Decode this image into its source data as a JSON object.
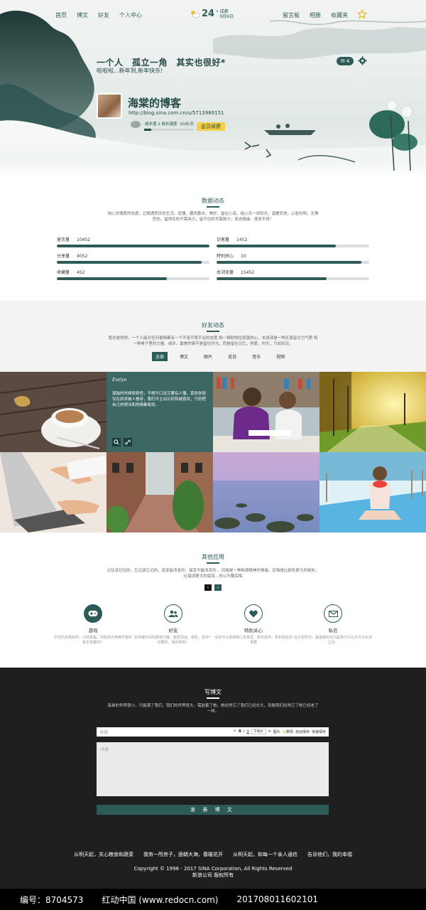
{
  "nav": {
    "left": [
      "首页",
      "博文",
      "好友",
      "个人中心"
    ],
    "right": [
      "留言板",
      "相册",
      "收藏夹"
    ]
  },
  "weather": {
    "temp": "24",
    "unit": "°",
    "city": "成都",
    "date": "9月6日"
  },
  "hero": {
    "motto": "一个人　孤立一角　其实也很好*",
    "sub_motto": "啦啦啦...新年到,新年快乐!",
    "badge": "4",
    "blog_title": "海棠的博客",
    "blog_url": "http://blog.sina.com.cn/u/5713989151",
    "growth_text": "成长值 1  成长速度 -10点/天",
    "growth_progress": 0.14,
    "renew_label": "会员续费"
  },
  "stats": {
    "title": "数据动态",
    "desc": "用心甘情愿的态度，过随遇而安的生活。道懂，趣风散去，美好，留在心底。给心灵一米阳光，温暖安放，心若向阳，无惧悲伤。留得住的不需用力，留不住的不需费力；来去随缘，很求不得！",
    "items": [
      {
        "label": "留言量",
        "value": "10452",
        "pct": 1.0
      },
      {
        "label": "访客量",
        "value": "1452",
        "pct": 0.78
      },
      {
        "label": "分享量",
        "value": "4052",
        "pct": 0.95
      },
      {
        "label": "特别关心",
        "value": "10",
        "pct": 0.95
      },
      {
        "label": "收藏量",
        "value": "452",
        "pct": 0.72
      },
      {
        "label": "总浏览量",
        "value": "15452",
        "pct": 0.72
      }
    ]
  },
  "friends": {
    "title": "好友动态",
    "desc": "我总是觉得，一个人能对任何事情都有一个不张不赘平淡的态度 和一颗耐得住寂寞的心，本身就是一种无畏皆引力气质 和一种骨子里的力量。或许，最美的事不是留住时光，而是留住记忆，但愿，时光，只如初见。",
    "tabs": [
      "全部",
      "博文",
      "图片",
      "说说",
      "音乐",
      "视频"
    ],
    "active_tab": 0,
    "overlay_logo": "Evelyn",
    "overlay_text": "孤独的时候很奇怪，不想开口说又要有人懂，喜欢你就仅在拼求被人看穿，我们不主动示好和被喜欢，只好把自己的想法和热情都收敛。"
  },
  "apps": {
    "title": "其他应用",
    "desc": "记住该记住的，忘记该忘记的。改变能改变的，接受不能改变的 。后悔是一种耗费精神的情绪，后悔是比损失更大的损失，比错误更大的错误，所以不要后悔",
    "pager": [
      "‹",
      "›"
    ],
    "items": [
      {
        "name": "游戏",
        "desc": "历史的天赋好时，已经来临，你能成为他俩宇宙的真正英雄吗？",
        "icon": "gamepad-icon"
      },
      {
        "name": "好友",
        "desc": "友情被时间的俯落与散，越发深远，朋友，爱你一切要好，我好想你！",
        "icon": "users-icon"
      },
      {
        "name": "特别关心",
        "desc": "没有什么值得用心去真爱，除非是你，赞和朋友的事要",
        "icon": "heart-icon"
      },
      {
        "name": "私信",
        "desc": "在大空时代，最最被的空间是我什么在东方对东法之间。",
        "icon": "mail-icon"
      }
    ]
  },
  "write": {
    "title": "写博文",
    "desc": "每弟的世界很小，只能满了我们。我们的世界很大，需励着了她。她经常忘了我们已经长大，就像我们经常忘了她已经老了一样。",
    "title_placeholder": "标题",
    "body_placeholder": "内容",
    "toolbar": [
      "B",
      "I",
      "U",
      "14px",
      "≡",
      "图片",
      "表情",
      "自动保存",
      "快速保存"
    ],
    "publish_label": "发 表 博 文"
  },
  "footer": {
    "links": [
      "从明天起，关心粮食和蔬菜",
      "我有一所房子，面朝大海，春暖花开",
      "从明天起，和每一个亲人通信",
      "告诉他们，我的幸福"
    ],
    "copyright": "Copyright © 1996 - 2017 SINA Corporation, All Rights Reserved",
    "company": "新浪公司 版权所有"
  },
  "watermark": {
    "id": "编号：8704573",
    "site": "红动中国 (www.redocn.com)",
    "code": "20170801160210‍1"
  },
  "colors": {
    "accent": "#2d5b57",
    "yellow": "#f4d046",
    "dark": "#1f1f1f"
  }
}
